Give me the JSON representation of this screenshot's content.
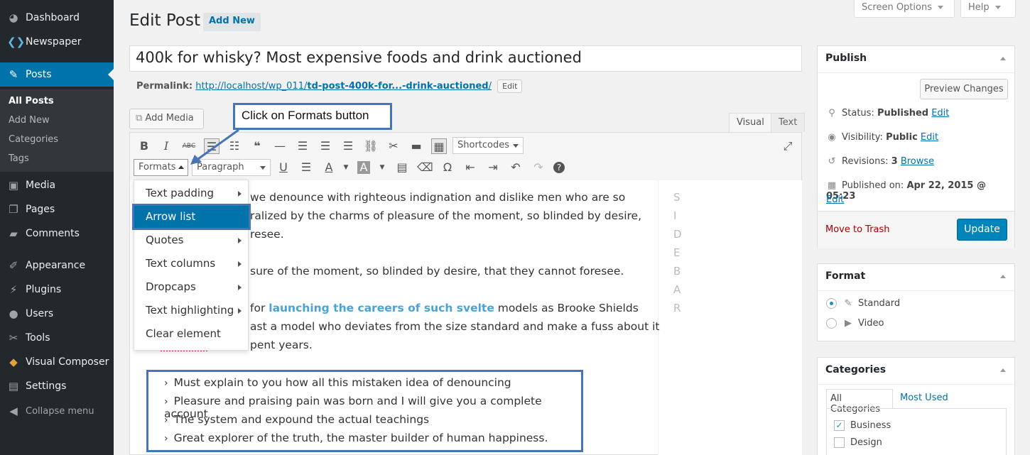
{
  "admin_menu": {
    "items": [
      {
        "label": "Dashboard",
        "icon": "dashboard-icon"
      },
      {
        "label": "Newspaper",
        "icon": "newspaper-icon"
      },
      {
        "label": "Posts",
        "icon": "pushpin-icon"
      },
      {
        "label": "Media",
        "icon": "media-icon"
      },
      {
        "label": "Pages",
        "icon": "pages-icon"
      },
      {
        "label": "Comments",
        "icon": "comments-icon"
      },
      {
        "label": "Appearance",
        "icon": "appearance-icon"
      },
      {
        "label": "Plugins",
        "icon": "plugins-icon"
      },
      {
        "label": "Users",
        "icon": "users-icon"
      },
      {
        "label": "Tools",
        "icon": "tools-icon"
      },
      {
        "label": "Visual Composer",
        "icon": "visual-composer-icon"
      },
      {
        "label": "Settings",
        "icon": "settings-icon"
      }
    ],
    "submenu": [
      "All Posts",
      "Add New",
      "Categories",
      "Tags"
    ],
    "collapse": "Collapse menu"
  },
  "top": {
    "screen_options": "Screen Options",
    "help": "Help"
  },
  "header": {
    "title": "Edit Post",
    "add_new": "Add New"
  },
  "post": {
    "title": "400k for whisky? Most expensive foods and drink auctioned",
    "permalink_label": "Permalink:",
    "permalink_base": "http://localhost/wp_011/",
    "permalink_slug": "td-post-400k-for...-drink-auctioned",
    "permalink_tail": "/",
    "edit": "Edit"
  },
  "editor": {
    "add_media": "Add Media",
    "tab_visual": "Visual",
    "tab_text": "Text",
    "shortcodes": "Shortcodes",
    "formats": "Formats",
    "paragraph": "Paragraph"
  },
  "callout": "Click on Formats button",
  "formats_menu": [
    "Text padding",
    "Arrow list",
    "Quotes",
    "Text columns",
    "Dropcaps",
    "Text highlighting",
    "Clear element"
  ],
  "content": {
    "p1a": "we denounce with righteous indignation and dislike men who are so",
    "p1b": "ralized by the charms of pleasure of the moment, so blinded by desire,",
    "p1c": "resee.",
    "p2": "sure of the moment, so blinded by desire, that they cannot foresee.",
    "p3a_pre": "for ",
    "p3a_link": "launching the careers of such svelte",
    "p3a_post": " models as Brooke Shields",
    "p3b": "ast a model who deviates from the size standard and make a fuss about it",
    "p3c": "pent years.",
    "list": [
      "Must explain to you how all this mistaken idea of denouncing",
      "Pleasure and praising pain was born and I will give you a complete account",
      "The system and expound the actual teachings",
      "Great explorer of the truth, the master builder of human happiness."
    ],
    "sidebar_letters": [
      "S",
      "I",
      "D",
      "E",
      "B",
      "A",
      "R"
    ]
  },
  "publish": {
    "title": "Publish",
    "preview": "Preview Changes",
    "status_label": "Status:",
    "status": "Published",
    "visibility_label": "Visibility:",
    "visibility": "Public",
    "revisions_label": "Revisions:",
    "revisions": "3",
    "browse": "Browse",
    "published_on_label": "Published on:",
    "published_on": "Apr 22, 2015 @ 05:23",
    "edit": "Edit",
    "trash": "Move to Trash",
    "update": "Update"
  },
  "format_box": {
    "title": "Format",
    "options": [
      "Standard",
      "Video"
    ]
  },
  "categories_box": {
    "title": "Categories",
    "tab_all": "All Categories",
    "tab_used": "Most Used",
    "items": [
      "Business",
      "Design"
    ]
  }
}
